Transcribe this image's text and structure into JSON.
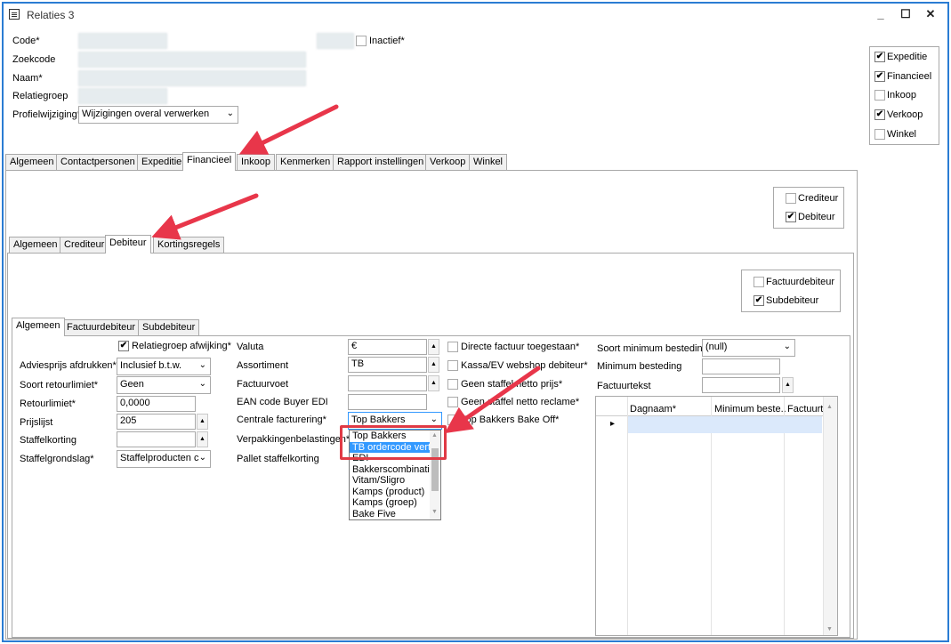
{
  "window": {
    "title": "Relaties 3",
    "min": "_",
    "max": "☐",
    "close": "✕"
  },
  "header": {
    "code_label": "Code*",
    "zoekcode_label": "Zoekcode",
    "naam_label": "Naam*",
    "relatiegroep_label": "Relatiegroep",
    "profielwijziging_label": "Profielwijziging*",
    "profielwijziging_value": "Wijzigingen overal verwerken",
    "inactief_label": "Inactief*"
  },
  "right_checks": [
    {
      "label": "Expeditie",
      "checked": "✔"
    },
    {
      "label": "Financieel",
      "checked": "✔"
    },
    {
      "label": "Inkoop",
      "checked": ""
    },
    {
      "label": "Verkoop",
      "checked": "✔"
    },
    {
      "label": "Winkel",
      "checked": ""
    }
  ],
  "main_tabs": [
    "Algemeen",
    "Contactpersonen",
    "Expeditie",
    "Financieel",
    "Inkoop",
    "Kenmerken",
    "Rapport instellingen",
    "Verkoop",
    "Winkel"
  ],
  "fin_checks": [
    {
      "label": "Crediteur",
      "checked": ""
    },
    {
      "label": "Debiteur",
      "checked": "✔"
    }
  ],
  "fin_tabs": [
    "Algemeen",
    "Crediteur",
    "Debiteur",
    "Kortingsregels"
  ],
  "deb_checks": [
    {
      "label": "Factuurdebiteur",
      "checked": ""
    },
    {
      "label": "Subdebiteur",
      "checked": "✔"
    }
  ],
  "deb_tabs": [
    "Algemeen",
    "Factuurdebiteur",
    "Subdebiteur"
  ],
  "col1": {
    "relatiegroep_afwijking": "Relatiegroep afwijking*",
    "relatiegroep_afwijking_checked": "✔",
    "adviesprijs_label": "Adviesprijs afdrukken*",
    "adviesprijs_value": "Inclusief b.t.w.",
    "soort_retourlimiet_label": "Soort retourlimiet*",
    "soort_retourlimiet_value": "Geen",
    "retourlimiet_label": "Retourlimiet*",
    "retourlimiet_value": "0,0000",
    "prijslijst_label": "Prijslijst",
    "prijslijst_value": "205",
    "staffelkorting_label": "Staffelkorting",
    "staffelgrondslag_label": "Staffelgrondslag*",
    "staffelgrondslag_value": "Staffelproducten c"
  },
  "col2": {
    "valuta_label": "Valuta",
    "valuta_value": "€",
    "assortiment_label": "Assortiment",
    "assortiment_value": "TB",
    "factuurvoet_label": "Factuurvoet",
    "ean_label": "EAN code Buyer EDI",
    "centrale_label": "Centrale facturering*",
    "centrale_value": "Top Bakkers",
    "verpakking_label": "Verpakkingenbelastingen*",
    "pallet_label": "Pallet staffelkorting"
  },
  "dropdown_options": [
    "Top Bakkers",
    "TB ordercode vert",
    "EDI",
    "Bakkerscombinatie",
    "Vitam/Sligro",
    "Kamps (product)",
    "Kamps (groep)",
    "Bake Five"
  ],
  "col3": [
    {
      "label": "Directe factuur toegestaan*",
      "checked": ""
    },
    {
      "label": "Kassa/EV webshop debiteur*",
      "checked": ""
    },
    {
      "label": "Geen staffel netto prijs*",
      "checked": ""
    },
    {
      "label": "Geen staffel netto reclame*",
      "checked": ""
    },
    {
      "label": "Top Bakkers Bake Off*",
      "checked": ""
    }
  ],
  "col4": {
    "soort_min_label": "Soort minimum besteding",
    "soort_min_value": "(null)",
    "min_besteding_label": "Minimum besteding",
    "factuurtekst_label": "Factuurtekst"
  },
  "grid": {
    "columns": [
      "Dagnaam*",
      "Minimum beste...",
      "Factuurt"
    ],
    "row_marker": "▸"
  }
}
